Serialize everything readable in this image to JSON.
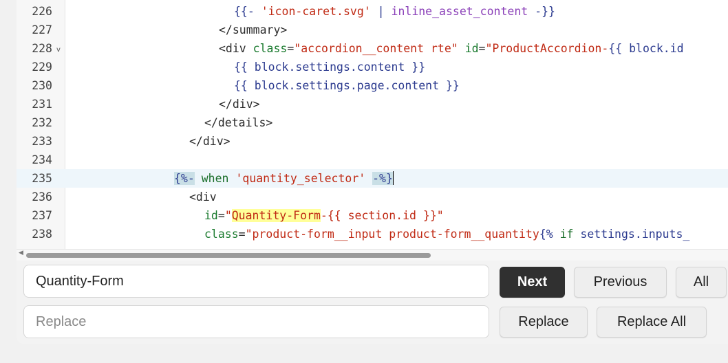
{
  "editor": {
    "lines": [
      {
        "num": "226"
      },
      {
        "num": "227"
      },
      {
        "num": "228",
        "fold": "v"
      },
      {
        "num": "229"
      },
      {
        "num": "230"
      },
      {
        "num": "231"
      },
      {
        "num": "232"
      },
      {
        "num": "233"
      },
      {
        "num": "234"
      },
      {
        "num": "235"
      },
      {
        "num": "236"
      },
      {
        "num": "237"
      },
      {
        "num": "238"
      }
    ],
    "tokens": {
      "l226": [
        "{{- ",
        "'icon-caret.svg'",
        " | ",
        "inline_asset_content",
        " -}}"
      ],
      "l227": [
        "</summary>"
      ],
      "l228": [
        "<div ",
        "class",
        "=",
        "\"accordion__content rte\"",
        " ",
        "id",
        "=",
        "\"ProductAccordion-",
        "{{ ",
        "block.id"
      ],
      "l229": [
        "{{ block.settings.content }}"
      ],
      "l230": [
        "{{ block.settings.page.content }}"
      ],
      "l231": [
        "</div>"
      ],
      "l232": [
        "</details>"
      ],
      "l233": [
        "</div>"
      ],
      "l235": [
        "{%-",
        " ",
        "when",
        " ",
        "'quantity_selector'",
        " ",
        "-%}"
      ],
      "l236": [
        "<div"
      ],
      "l237": [
        "id",
        "=",
        "\"",
        "Quantity-Form",
        "-{{ section.id }}\""
      ],
      "l238": [
        "class",
        "=",
        "\"product-form__input product-form__quantity",
        "{%",
        " ",
        "if",
        " ",
        "settings.inputs_"
      ]
    }
  },
  "search": {
    "find_value": "Quantity-Form",
    "replace_placeholder": "Replace"
  },
  "buttons": {
    "next": "Next",
    "previous": "Previous",
    "all": "All",
    "replace": "Replace",
    "replace_all": "Replace All"
  },
  "colors": {
    "primary_button": "#303030",
    "match_highlight": "#ffff99",
    "active_line": "#eef6fb"
  }
}
